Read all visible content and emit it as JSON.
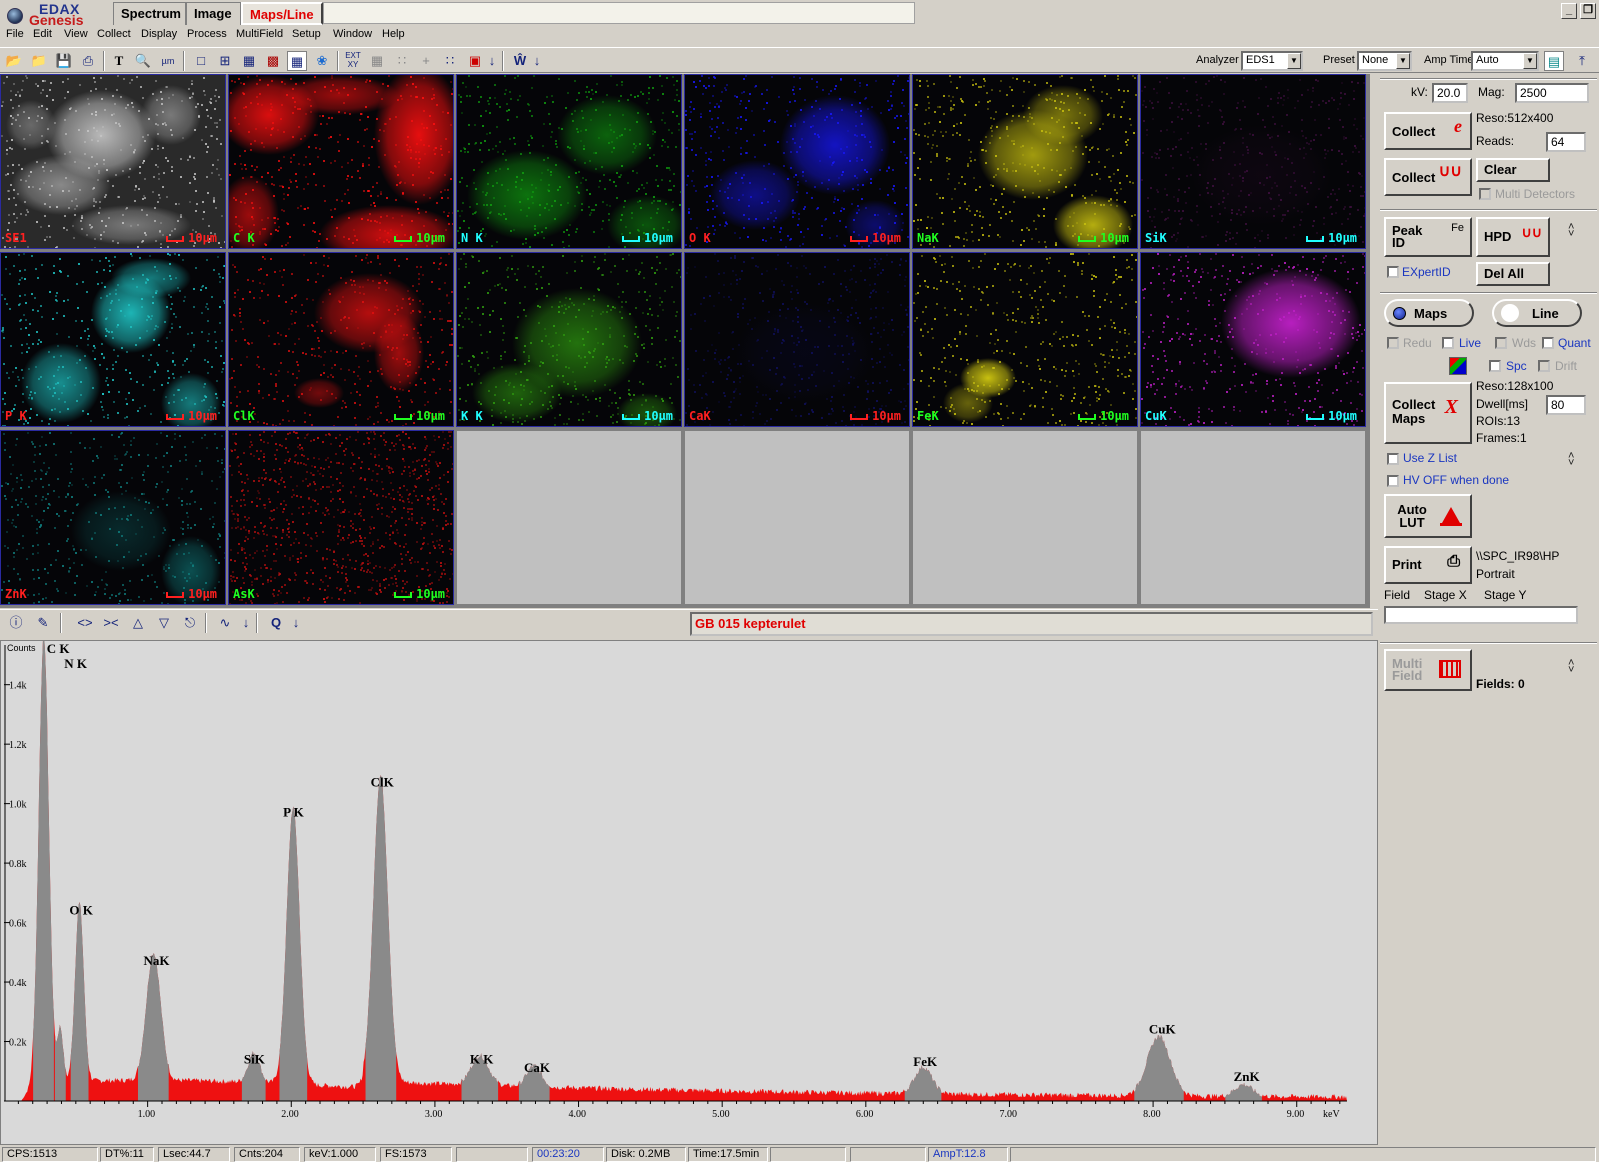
{
  "app": {
    "brand_top": "EDAX",
    "brand_bottom": "Genesis"
  },
  "tabs": [
    {
      "label": "Spectrum"
    },
    {
      "label": "Image"
    },
    {
      "label": "Maps/Line",
      "active": true
    }
  ],
  "window_buttons": {
    "minimize": "_",
    "restore": "❐"
  },
  "menu": [
    "File",
    "Edit",
    "View",
    "Collect",
    "Display",
    "Process",
    "MultiField",
    "Setup",
    "Window",
    "Help"
  ],
  "toolbar": {
    "analyzer_label": "Analyzer",
    "analyzer_value": "EDS1",
    "preset_label": "Preset",
    "preset_value": "None",
    "amptime_label": "Amp Time",
    "amptime_value": "Auto"
  },
  "maps": [
    {
      "label": "SE1",
      "scale": "10µm",
      "label_color": "#ff2020",
      "scale_color": "#ff2020",
      "tint": "#c8c8c8",
      "kind": "se"
    },
    {
      "label": "C K",
      "scale": "10µm",
      "label_color": "#20ff20",
      "scale_color": "#20ff20",
      "tint": "#ff1010",
      "kind": "c"
    },
    {
      "label": "N K",
      "scale": "10µm",
      "label_color": "#20ffff",
      "scale_color": "#20ffff",
      "tint": "#10a010",
      "kind": "n"
    },
    {
      "label": "O K",
      "scale": "10µm",
      "label_color": "#ff2020",
      "scale_color": "#ff2020",
      "tint": "#1818ff",
      "kind": "o"
    },
    {
      "label": "NaK",
      "scale": "10µm",
      "label_color": "#20ff20",
      "scale_color": "#20ff20",
      "tint": "#c8c010",
      "kind": "na"
    },
    {
      "label": "SiK",
      "scale": "10µm",
      "label_color": "#20ffff",
      "scale_color": "#20ffff",
      "tint": "#401040",
      "kind": "si"
    },
    {
      "label": "P K",
      "scale": "10µm",
      "label_color": "#ff2020",
      "scale_color": "#ff2020",
      "tint": "#20c8c8",
      "kind": "p"
    },
    {
      "label": "ClK",
      "scale": "10µm",
      "label_color": "#20ff20",
      "scale_color": "#20ff20",
      "tint": "#e01010",
      "kind": "cl"
    },
    {
      "label": "K K",
      "scale": "10µm",
      "label_color": "#20ffff",
      "scale_color": "#20ffff",
      "tint": "#30a010",
      "kind": "k"
    },
    {
      "label": "CaK",
      "scale": "10µm",
      "label_color": "#ff2020",
      "scale_color": "#ff2020",
      "tint": "#101060",
      "kind": "ca"
    },
    {
      "label": "FeK",
      "scale": "10µm",
      "label_color": "#20ff20",
      "scale_color": "#20ff20",
      "tint": "#c8c010",
      "kind": "fe"
    },
    {
      "label": "CuK",
      "scale": "10µm",
      "label_color": "#20ffff",
      "scale_color": "#20ffff",
      "tint": "#c020c8",
      "kind": "cu"
    },
    {
      "label": "ZnK",
      "scale": "10µm",
      "label_color": "#ff2020",
      "scale_color": "#ff2020",
      "tint": "#108080",
      "kind": "zn"
    },
    {
      "label": "AsK",
      "scale": "10µm",
      "label_color": "#20ff20",
      "scale_color": "#20ff20",
      "tint": "#c01010",
      "kind": "as"
    }
  ],
  "spectrum": {
    "title": "GB 015 kepterulet",
    "y_label": "Counts",
    "x_unit": "keV",
    "y_ticks": [
      "0.2k",
      "0.4k",
      "0.6k",
      "0.8k",
      "1.0k",
      "1.2k",
      "1.4k"
    ],
    "x_ticks": [
      "1.00",
      "2.00",
      "3.00",
      "4.00",
      "5.00",
      "6.00",
      "7.00",
      "8.00",
      "9.00"
    ],
    "x_max_kev": 9.35,
    "y_max_counts": 1520,
    "peaks": [
      {
        "label": "C K",
        "kev": 0.277,
        "counts": 1500,
        "width": 0.035
      },
      {
        "label": "N K",
        "kev": 0.392,
        "counts": 180,
        "width": 0.02
      },
      {
        "label": "O K",
        "kev": 0.525,
        "counts": 600,
        "width": 0.03
      },
      {
        "label": "NaK",
        "kev": 1.041,
        "counts": 430,
        "width": 0.05
      },
      {
        "label": "SiK",
        "kev": 1.74,
        "counts": 100,
        "width": 0.04
      },
      {
        "label": "P K",
        "kev": 2.013,
        "counts": 930,
        "width": 0.045
      },
      {
        "label": "ClK",
        "kev": 2.622,
        "counts": 1030,
        "width": 0.05
      },
      {
        "label": "K K",
        "kev": 3.313,
        "counts": 100,
        "width": 0.06
      },
      {
        "label": "CaK",
        "kev": 3.69,
        "counts": 70,
        "width": 0.05
      },
      {
        "label": "FeK",
        "kev": 6.4,
        "counts": 90,
        "width": 0.06
      },
      {
        "label": "CuK",
        "kev": 8.04,
        "counts": 200,
        "width": 0.08
      },
      {
        "label": "ZnK",
        "kev": 8.63,
        "counts": 40,
        "width": 0.06
      }
    ]
  },
  "panel": {
    "kv_label": "kV:",
    "kv_value": "20.0",
    "mag_label": "Mag:",
    "mag_value": "2500",
    "reso_img": "Reso:512x400",
    "reads_label": "Reads:",
    "reads_value": "64",
    "collect_img": "Collect",
    "collect_spc": "Collect",
    "clear": "Clear",
    "multi_detectors": "Multi Detectors",
    "peak_id": "Peak ID",
    "peak_id_fe": "Fe",
    "hpd": "HPD",
    "expertid": "EXpertID",
    "del_all": "Del All",
    "maps": "Maps",
    "line": "Line",
    "redu": "Redu",
    "live": "Live",
    "wds": "Wds",
    "quant": "Quant",
    "spc": "Spc",
    "drift": "Drift",
    "reso_map": "Reso:128x100",
    "dwell_label": "Dwell[ms]",
    "dwell_value": "80",
    "rois": "ROIs:13",
    "frames": "Frames:1",
    "collect_maps": "Collect Maps",
    "use_z_list": "Use Z List",
    "hv_off": "HV OFF when done",
    "auto_lut": "Auto LUT",
    "print": "Print",
    "printer": "\\\\SPC_IR98\\HP",
    "orientation": "Portrait",
    "field": "Field",
    "stage_x": "Stage X",
    "stage_y": "Stage Y",
    "multi_field": "Multi Field",
    "fields": "Fields: 0"
  },
  "status": {
    "cps": "CPS:1513",
    "dt": "DT%:11",
    "lsec": "Lsec:44.7",
    "cnts": "Cnts:204",
    "kev": "keV:1.000",
    "fs": "FS:1573",
    "clock": "00:23:20",
    "disk": "Disk: 0.2MB",
    "time": "Time:17.5min",
    "ampt": "AmpT:12.8"
  }
}
